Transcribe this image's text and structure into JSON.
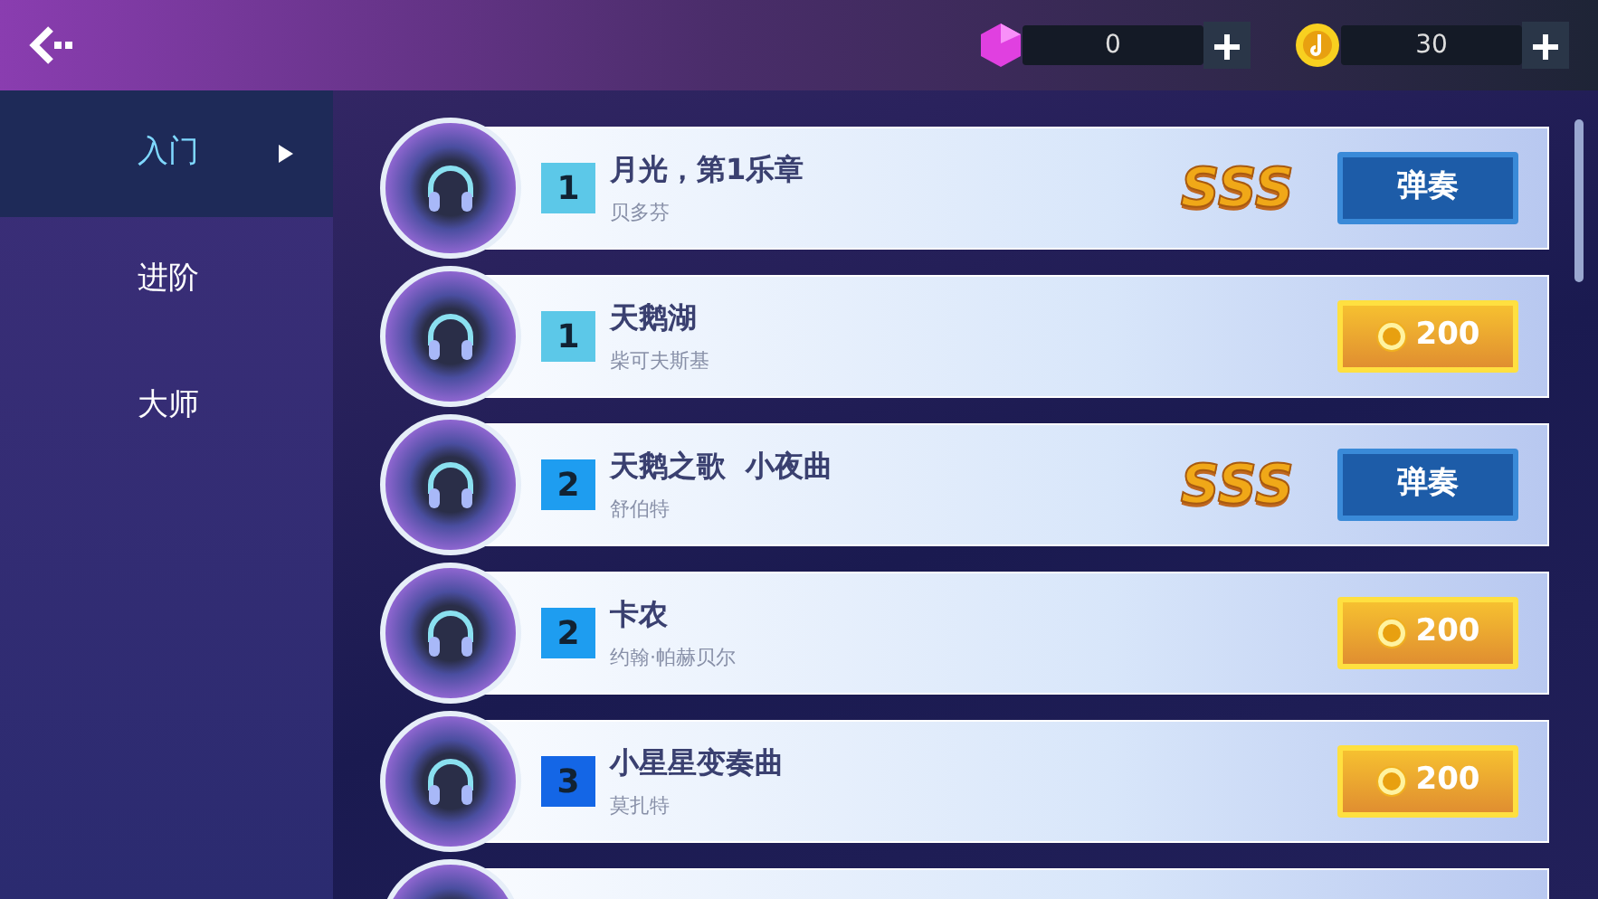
{
  "top_bar": {
    "gems": "0",
    "coins": "30"
  },
  "sidebar": {
    "items": [
      {
        "label": "入门",
        "selected": true
      },
      {
        "label": "进阶",
        "selected": false
      },
      {
        "label": "大师",
        "selected": false
      }
    ]
  },
  "songs": [
    {
      "level": "1",
      "color": "#5cc8e8",
      "title": "月光，第1乐章",
      "composer": "贝多芬",
      "rank": "SSS",
      "action": {
        "kind": "play",
        "label": "弹奏"
      }
    },
    {
      "level": "1",
      "color": "#5cc8e8",
      "title": "天鹅湖",
      "composer": "柴可夫斯基",
      "action": {
        "kind": "price",
        "label": "200"
      }
    },
    {
      "level": "2",
      "color": "#1e9df0",
      "title": "天鹅之歌  小夜曲",
      "composer": "舒伯特",
      "rank": "SSS",
      "action": {
        "kind": "play",
        "label": "弹奏"
      }
    },
    {
      "level": "2",
      "color": "#1e9df0",
      "title": "卡农",
      "composer": "约翰·帕赫贝尔",
      "action": {
        "kind": "price",
        "label": "200"
      }
    },
    {
      "level": "3",
      "color": "#1466e6",
      "title": "小星星变奏曲",
      "composer": "莫扎特",
      "action": {
        "kind": "price",
        "label": "200"
      }
    }
  ],
  "more_below": true
}
